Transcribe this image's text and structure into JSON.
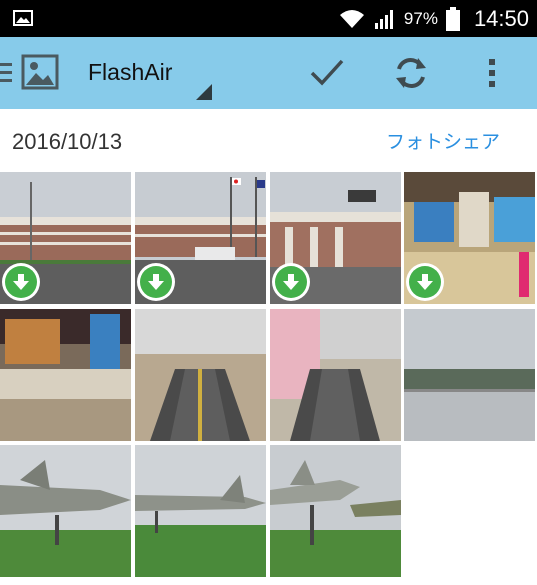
{
  "status_bar": {
    "battery_percent": "97%",
    "time": "14:50",
    "icons": [
      "image-notification-icon",
      "wifi-icon",
      "signal-icon",
      "battery-icon"
    ]
  },
  "app_bar": {
    "title": "FlashAir",
    "actions": [
      "check-icon",
      "sync-icon",
      "more-vert-icon"
    ],
    "color": "#87cbea"
  },
  "date_section": {
    "date": "2016/10/13",
    "share_label": "フォトシェア",
    "share_color": "#2a8fe0"
  },
  "photos": [
    {
      "subject": "airport-exterior",
      "downloadable": true
    },
    {
      "subject": "airport-exterior-flags",
      "downloadable": true
    },
    {
      "subject": "terminal-entrance",
      "downloadable": true
    },
    {
      "subject": "terminal-interior-shops",
      "downloadable": true
    },
    {
      "subject": "terminal-interior-banners",
      "downloadable": false
    },
    {
      "subject": "escalator-hall",
      "downloadable": false
    },
    {
      "subject": "escalator-cherry-blossom",
      "downloadable": false
    },
    {
      "subject": "observation-deck-view",
      "downloadable": false
    },
    {
      "subject": "fighter-jet-display-1",
      "downloadable": false
    },
    {
      "subject": "fighter-jet-display-2",
      "downloadable": false
    },
    {
      "subject": "fighter-jet-display-3",
      "downloadable": false
    }
  ]
}
